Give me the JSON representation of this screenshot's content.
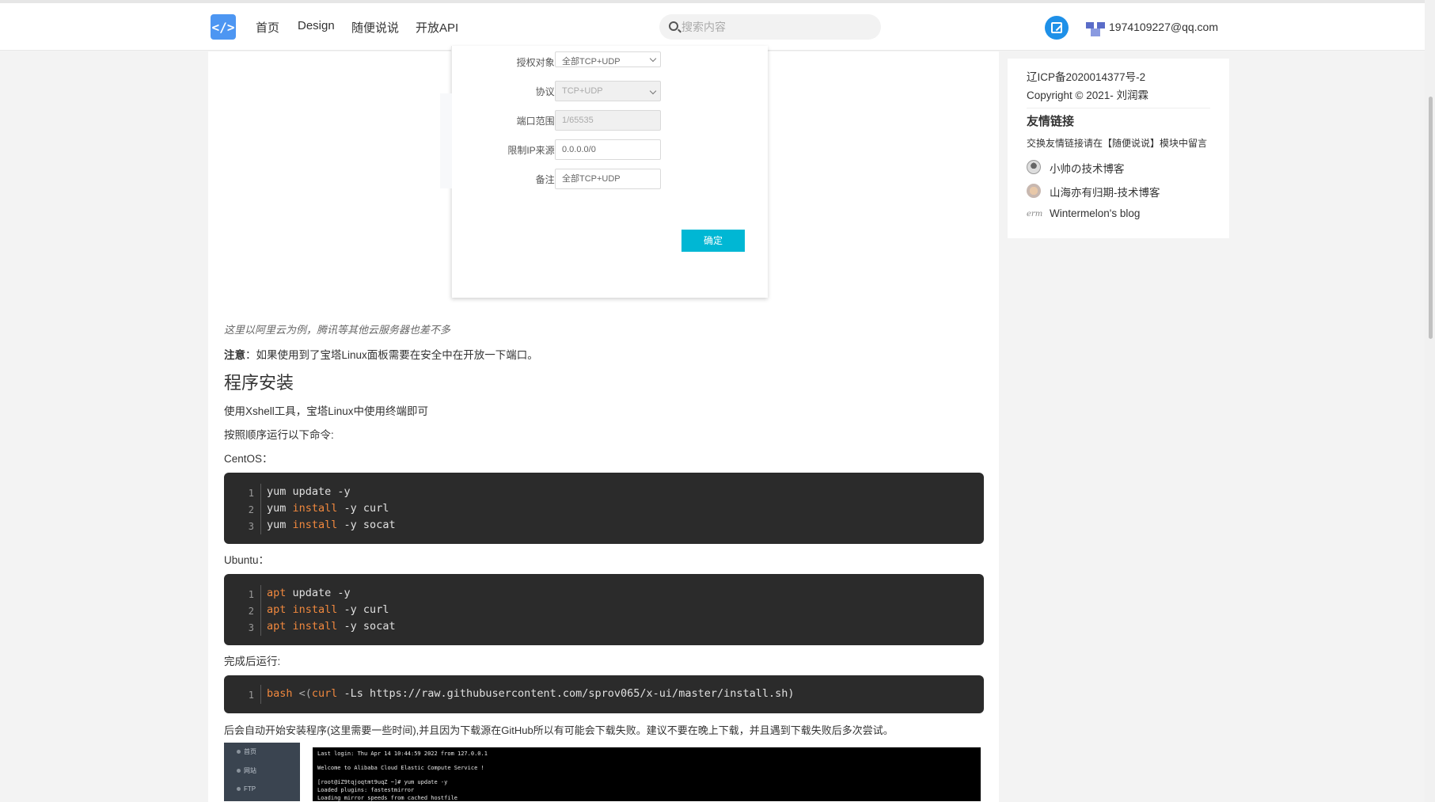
{
  "nav": {
    "logo_text": "</>",
    "items": [
      "首页",
      "Design",
      "随便说说",
      "开放API"
    ],
    "search_placeholder": "搜索内容",
    "user_email": "1974109227@qq.com"
  },
  "form": {
    "fields": [
      {
        "label": "授权对象:",
        "value": "全部TCP+UDP"
      },
      {
        "label": "协议:",
        "value": "TCP+UDP"
      },
      {
        "label": "端口范围:",
        "value": "1/65535"
      },
      {
        "label": "限制IP来源:",
        "value": "0.0.0.0/0"
      },
      {
        "label": "备注:",
        "value": "全部TCP+UDP"
      }
    ],
    "confirm_label": "确定"
  },
  "article": {
    "caption": "这里以阿里云为例，腾讯等其他云服务器也差不多",
    "note_label": "注意",
    "note_text": "：如果使用到了宝塔Linux面板需要在安全中在开放一下端口。",
    "heading": "程序安装",
    "p1": "使用Xshell工具，宝塔Linux中使用终端即可",
    "p2": "按照顺序运行以下命令:",
    "centos_label": "CentOS：",
    "centos_code": [
      {
        "n": "1",
        "a": "",
        "b": "yum update -y",
        "c": "",
        "d": ""
      },
      {
        "n": "2",
        "a": "",
        "b": "yum ",
        "c": "install",
        "d": " -y curl"
      },
      {
        "n": "3",
        "a": "",
        "b": "yum ",
        "c": "install",
        "d": " -y socat"
      }
    ],
    "ubuntu_label": "Ubuntu：",
    "ubuntu_code": [
      {
        "n": "1",
        "kw": "apt",
        "rest": " update -y"
      },
      {
        "n": "2",
        "kw": "apt",
        "kw2": " install",
        "rest": " -y curl"
      },
      {
        "n": "3",
        "kw": "apt",
        "kw2": " install",
        "rest": " -y socat"
      }
    ],
    "after_label": "完成后运行:",
    "install_line_no": "1",
    "install_kw": "bash",
    "install_mid": " <(",
    "install_kw2": "curl",
    "install_rest": " -Ls https://raw.githubusercontent.com/sprov065/x-ui/master/install.sh)",
    "p_final": "后会自动开始安装程序(这里需要一些时间),并且因为下载源在GitHub所以有可能会下载失败。建议不要在晚上下载，并且遇到下载失败后多次尝试。"
  },
  "screenshot": {
    "side_items": [
      "首页",
      "网站",
      "FTP"
    ],
    "term_lines": [
      "Last login: Thu Apr 14 10:44:59 2022 from 127.0.0.1",
      "Welcome to Alibaba Cloud Elastic Compute Service !",
      "[root@iZ9tqjoqtmt9uqZ ~]# yum update -y",
      "Loaded plugins: fastestmirror",
      "Loading mirror speeds from cached hostfile"
    ]
  },
  "sidebar": {
    "icp": "辽ICP备2020014377号-2",
    "copyright": "Copyright © 2021- 刘润霖",
    "links_title": "友情链接",
    "links_hint": "交换友情链接请在【随便说说】模块中留言",
    "links": [
      "小帅の技术博客",
      "山海亦有归期-技术博客",
      "Wintermelon's blog"
    ],
    "link3_icon_text": "erm"
  }
}
